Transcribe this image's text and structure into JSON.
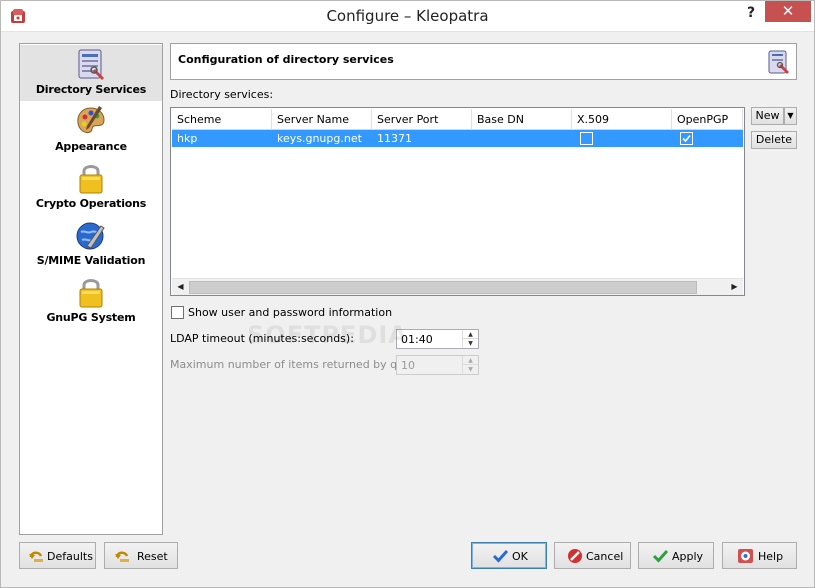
{
  "window": {
    "title": "Configure – Kleopatra",
    "help_glyph": "?",
    "close_glyph": "✕"
  },
  "sidebar": {
    "items": [
      {
        "label": "Directory Services",
        "icon": "directory-services-icon",
        "selected": true
      },
      {
        "label": "Appearance",
        "icon": "palette-icon",
        "selected": false
      },
      {
        "label": "Crypto Operations",
        "icon": "padlock-icon",
        "selected": false
      },
      {
        "label": "S/MIME Validation",
        "icon": "globe-wrench-icon",
        "selected": false
      },
      {
        "label": "GnuPG System",
        "icon": "padlock-icon",
        "selected": false
      }
    ]
  },
  "header": {
    "title": "Configuration of directory services",
    "icon": "directory-services-icon"
  },
  "directory": {
    "label": "Directory services:",
    "columns": [
      "Scheme",
      "Server Name",
      "Server Port",
      "Base DN",
      "X.509",
      "OpenPGP"
    ],
    "rows": [
      {
        "scheme": "hkp",
        "server_name": "keys.gnupg.net",
        "server_port": "11371",
        "base_dn": "",
        "x509": false,
        "openpgp": true
      }
    ],
    "new_label": "New",
    "delete_label": "Delete",
    "dropdown_arrow": "▼",
    "scroll_left": "◀",
    "scroll_right": "▶"
  },
  "options": {
    "show_user_password_label": "Show user and password information",
    "show_user_password_checked": false,
    "ldap_timeout_label": "LDAP timeout (minutes:seconds):",
    "ldap_timeout_value": "01:40",
    "max_items_label": "Maximum number of items returned by query:",
    "max_items_value": "10",
    "spin_up": "▲",
    "spin_down": "▼"
  },
  "buttons": {
    "defaults": "Defaults",
    "reset": "Reset",
    "ok": "OK",
    "cancel": "Cancel",
    "apply": "Apply",
    "help": "Help"
  },
  "watermark": "SOFTPEDIA",
  "colors": {
    "selection": "#3399ff",
    "close_button": "#c75050",
    "sidebar_selected": "#e3e3e3"
  }
}
